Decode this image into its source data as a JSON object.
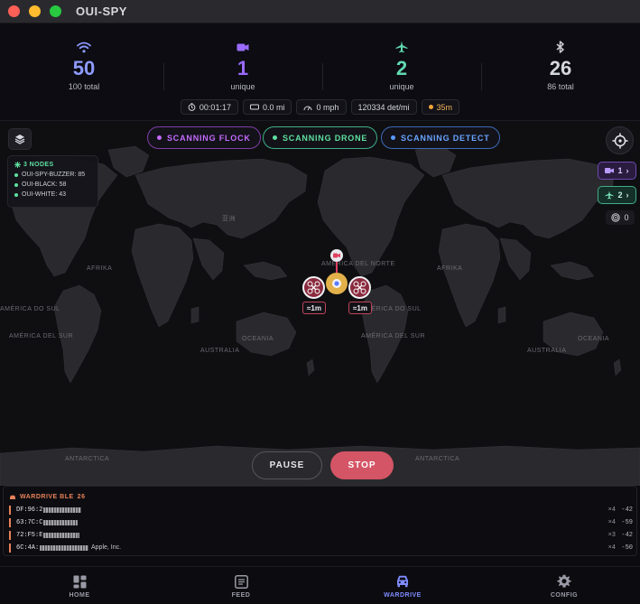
{
  "window": {
    "title": "OUI-SPY"
  },
  "stats": [
    {
      "value": "50",
      "sub": "100 total",
      "icon": "wifi-icon",
      "color": "#8e9bff"
    },
    {
      "value": "1",
      "sub": "unique",
      "icon": "video-camera-icon",
      "color": "#9a6bff"
    },
    {
      "value": "2",
      "sub": "unique",
      "icon": "airplane-icon",
      "color": "#62d8b0"
    },
    {
      "value": "26",
      "sub": "86 total",
      "icon": "bluetooth-icon",
      "color": "#c9c9d2"
    }
  ],
  "pills": {
    "timer": "00:01:17",
    "distance": "0.0 mi",
    "speed": "0 mph",
    "rate": "120334 det/mi",
    "accuracy": "35m"
  },
  "scan_buttons": [
    {
      "label": "SCANNING FLOCK",
      "color": "#c46bff"
    },
    {
      "label": "SCANNING DRONE",
      "color": "#5fe0a0"
    },
    {
      "label": "SCANNING DETECT",
      "color": "#5a9bff"
    }
  ],
  "nodes": {
    "header": "3 NODES",
    "items": [
      "OUI-SPY-BUZZER: 85",
      "OUI-BLACK: 58",
      "OUI-WHITE: 43"
    ]
  },
  "side": {
    "camera_count": "1",
    "drone_count": "2",
    "radar_count": "0"
  },
  "map_labels": {
    "north_america_left": "AMÉRICA DEL NORTE",
    "north_america_right": "AMÉRICA DEL NORTE",
    "south_america_left": "AMÉRICA DO SUL",
    "south_america_right": "AMÉRICA DO SUL",
    "south_america_left_2": "AMÉRICA DEL SUR",
    "south_america_right_2": "AMÉRICA DEL SUR",
    "africa": "AFRIKA",
    "africa_2": "AFRIKA",
    "australia_left": "AUSTRALIA",
    "australia_right": "AUSTRALIA",
    "oceania_left": "OCEANIA",
    "oceania_right": "OCEANIA",
    "antarctica_left": "ANTARCTICA",
    "antarctica_right": "ANTARCTICA",
    "asia_glyph": "亚洲"
  },
  "markers": {
    "left_dist": "≈1m",
    "right_dist": "≈1m"
  },
  "controls": {
    "pause": "PAUSE",
    "stop": "STOP"
  },
  "wardrive": {
    "header": "WARDRIVE BLE",
    "count": "26",
    "rows": [
      {
        "mac": "DF:96:2",
        "vendor": "",
        "count": "×4",
        "rssi": "-42"
      },
      {
        "mac": "63:7C:C",
        "vendor": "",
        "count": "×4",
        "rssi": "-59"
      },
      {
        "mac": "72:F5:E",
        "vendor": "",
        "count": "×3",
        "rssi": "-42"
      },
      {
        "mac": "6C:4A:",
        "vendor": "Apple, Inc.",
        "count": "×4",
        "rssi": "-50"
      }
    ]
  },
  "tabs": [
    {
      "label": "HOME",
      "icon": "grid-icon"
    },
    {
      "label": "FEED",
      "icon": "feed-list-icon"
    },
    {
      "label": "WARDRIVE",
      "icon": "car-icon",
      "active": true
    },
    {
      "label": "CONFIG",
      "icon": "gear-icon"
    }
  ]
}
